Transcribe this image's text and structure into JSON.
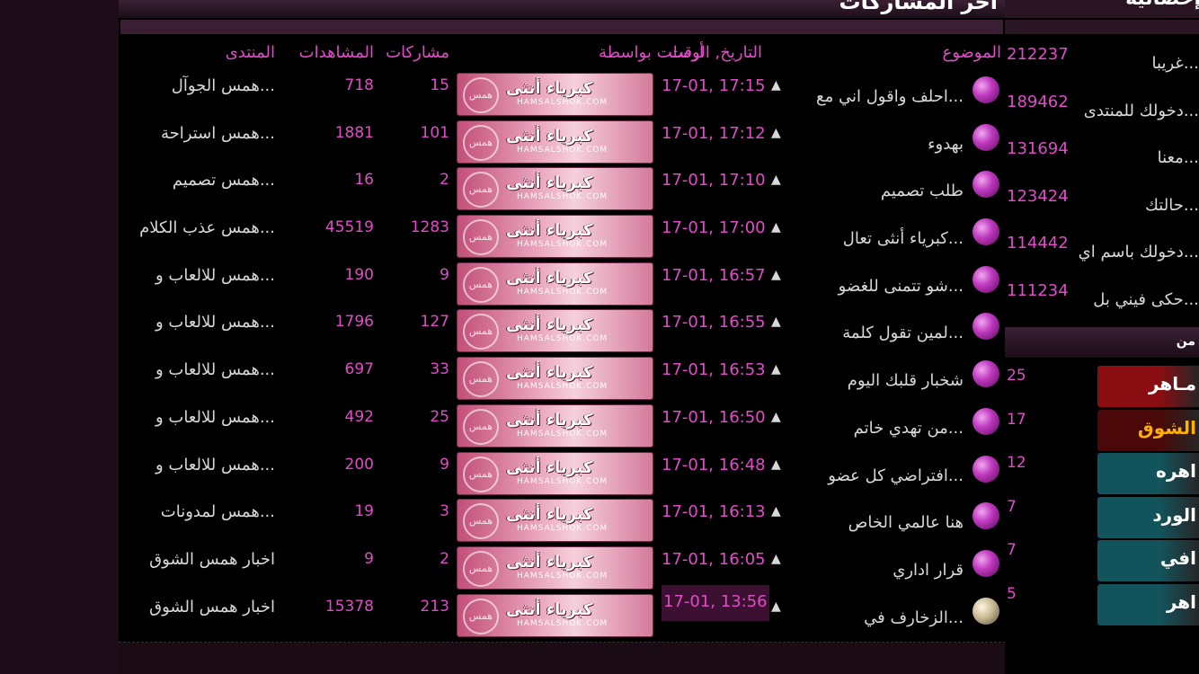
{
  "panel": {
    "title": "آخر المشاركات",
    "headers": {
      "forum": "المنتدى",
      "views": "المشاهدات",
      "replies": "مشاركات",
      "sender": "أرسلت بواسطة",
      "datetime": "التاريخ, الوقت",
      "topic": "الموضوع"
    },
    "banner_name": "كبرياء أنثى",
    "banner_watermark": "HAMSALSHOK.COM",
    "banner_seal": "همس الشوق",
    "rows": [
      {
        "forum": "همس الجوآل...",
        "views": "718",
        "replies": "15",
        "date": "17-01, 17:15",
        "topic": "احلف واقول اني مع..."
      },
      {
        "forum": "همس استراحة...",
        "views": "1881",
        "replies": "101",
        "date": "17-01, 17:12",
        "topic": "بهدوء"
      },
      {
        "forum": "همس تصميم...",
        "views": "16",
        "replies": "2",
        "date": "17-01, 17:10",
        "topic": "طلب تصميم"
      },
      {
        "forum": "همس عذب الكلام...",
        "views": "45519",
        "replies": "1283",
        "date": "17-01, 17:00",
        "topic": "كبرياء أنثى تعال..."
      },
      {
        "forum": "همس للالعاب و...",
        "views": "190",
        "replies": "9",
        "date": "17-01, 16:57",
        "topic": "شو تتمنى للغضو..."
      },
      {
        "forum": "همس للالعاب و...",
        "views": "1796",
        "replies": "127",
        "date": "17-01, 16:55",
        "topic": "لمين تقول كلمة..."
      },
      {
        "forum": "همس للالعاب و...",
        "views": "697",
        "replies": "33",
        "date": "17-01, 16:53",
        "topic": "شخبار قلبك اليوم"
      },
      {
        "forum": "همس للالعاب و...",
        "views": "492",
        "replies": "25",
        "date": "17-01, 16:50",
        "topic": "من تهدي خاتم..."
      },
      {
        "forum": "همس للالعاب و...",
        "views": "200",
        "replies": "9",
        "date": "17-01, 16:48",
        "topic": "افتراضي كل عضو..."
      },
      {
        "forum": "همس لمدونات...",
        "views": "19",
        "replies": "3",
        "date": "17-01, 16:13",
        "topic": "هنا عالمي الخاص"
      },
      {
        "forum": "اخبار همس الشوق",
        "views": "9",
        "replies": "2",
        "date": "17-01, 16:05",
        "topic": "قرار اداري"
      },
      {
        "forum": "اخبار همس الشوق",
        "views": "15378",
        "replies": "213",
        "date": "17-01, 13:56",
        "topic": "الزخارف في..."
      }
    ]
  },
  "sidebar": {
    "title": "إحصائية",
    "items": [
      {
        "num": "212237",
        "text": "غريبا..."
      },
      {
        "num": "189462",
        "text": "دخولك للمنتدى..."
      },
      {
        "num": "131694",
        "text": "معنا..."
      },
      {
        "num": "123424",
        "text": "حالتك..."
      },
      {
        "num": "114442",
        "text": "دخولك باسم اي..."
      },
      {
        "num": "111234",
        "text": "حكى فيني بل..."
      }
    ],
    "members_title": "من",
    "members": [
      {
        "count": "25",
        "name": "مـاهر",
        "bg": "#8a0d12",
        "color": "#ffffff"
      },
      {
        "count": "17",
        "name": "الشوق",
        "bg": "#4a0808",
        "color": "#ffb000"
      },
      {
        "count": "12",
        "name": "اهره",
        "bg": "#12545c",
        "color": "#ffffff"
      },
      {
        "count": "7",
        "name": "الورد",
        "bg": "#12545c",
        "color": "#ffffff"
      },
      {
        "count": "7",
        "name": "افي",
        "bg": "#12545c",
        "color": "#ffffff"
      },
      {
        "count": "5",
        "name": "اهر",
        "bg": "#12545c",
        "color": "#ffffff"
      }
    ]
  }
}
